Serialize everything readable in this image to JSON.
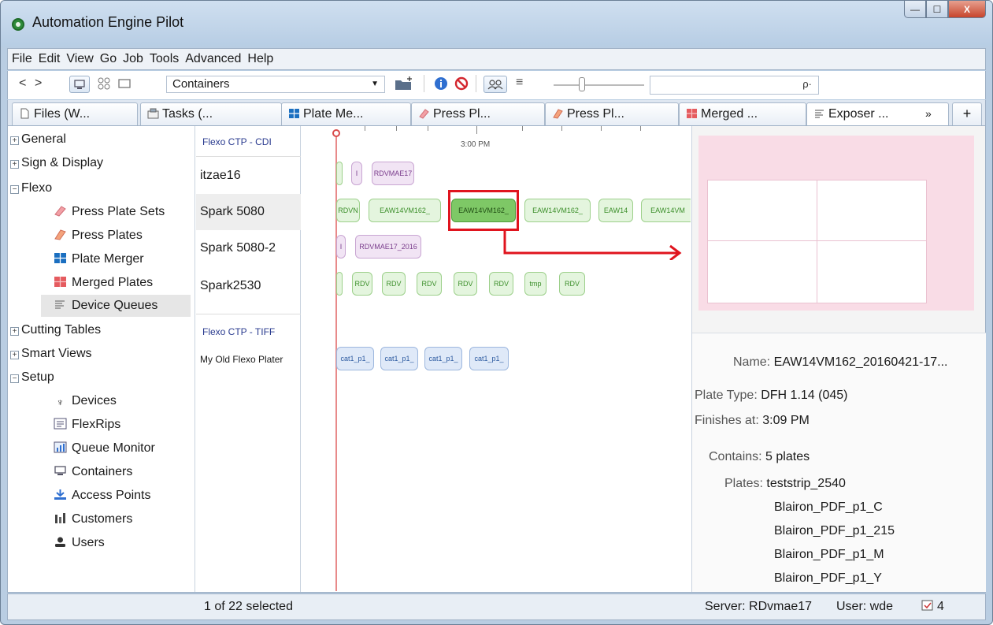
{
  "window": {
    "title": "Automation Engine Pilot",
    "minimize": "—",
    "maximize": "☐",
    "close": "X"
  },
  "menu": [
    "File",
    "Edit",
    "View",
    "Go",
    "Job",
    "Tools",
    "Advanced",
    "Help"
  ],
  "toolbar": {
    "back": "<",
    "forward": ">",
    "view_combo": "Containers",
    "search_placeholder": "",
    "search_icon": "ρ·"
  },
  "tabs": [
    {
      "label": "Files (W...",
      "icon": "file-icon"
    },
    {
      "label": "Tasks (...",
      "icon": "tasks-icon"
    },
    {
      "label": "Plate Me...",
      "icon": "plate-merger-icon"
    },
    {
      "label": "Press Pl...",
      "icon": "press-plate-sets-icon"
    },
    {
      "label": "Press Pl...",
      "icon": "press-plates-icon"
    },
    {
      "label": "Merged ...",
      "icon": "merged-plates-icon"
    },
    {
      "label": "Exposer ...",
      "icon": "device-queues-icon"
    },
    {
      "label": "»"
    },
    {
      "label": "+"
    }
  ],
  "sidebar": {
    "general": "General",
    "sign_display": "Sign & Display",
    "flexo": "Flexo",
    "flexo_items": [
      "Press Plate Sets",
      "Press Plates",
      "Plate Merger",
      "Merged Plates",
      "Device Queues"
    ],
    "cutting_tables": "Cutting Tables",
    "smart_views": "Smart Views",
    "setup": "Setup",
    "setup_items": [
      "Devices",
      "FlexRips",
      "Queue Monitor",
      "Containers",
      "Access Points",
      "Customers",
      "Users"
    ]
  },
  "devices": {
    "group1": "Flexo CTP - CDI",
    "rows1": [
      "itzae16",
      "Spark 5080",
      "Spark 5080-2",
      "Spark2530"
    ],
    "group2": "Flexo CTP - TIFF",
    "rows2": [
      "My Old Flexo Plater"
    ]
  },
  "timeline": {
    "time_label": "3:00 PM",
    "row1": [
      "I",
      "RDVMAE17"
    ],
    "row2": [
      "RDVN",
      "EAW14VM162_",
      "EAW14VM162_",
      "EAW14VM162_",
      "EAW14",
      "EAW14VM"
    ],
    "row3": [
      "I",
      "RDVMAE17_2016"
    ],
    "row4": [
      "",
      "RDV",
      "RDV",
      "RDV",
      "RDV",
      "RDV",
      "tmp",
      "RDV"
    ],
    "row5": [
      "cat1_p1_",
      "cat1_p1_",
      "cat1_p1_",
      "cat1_p1_"
    ]
  },
  "details": {
    "name_label": "Name:",
    "name_value": "EAW14VM162_20160421-17...",
    "plate_type_label": "Plate Type:",
    "plate_type_value": "DFH 1.14 (045)",
    "finishes_label": "Finishes at:",
    "finishes_value": "3:09 PM",
    "contains_label": "Contains:",
    "contains_value": "5 plates",
    "plates_label": "Plates:",
    "plates": [
      "teststrip_2540",
      "Blairon_PDF_p1_C",
      "Blairon_PDF_p1_215",
      "Blairon_PDF_p1_M",
      "Blairon_PDF_p1_Y"
    ]
  },
  "status": {
    "selection": "1 of 22 selected",
    "server": "Server: RDvmae17",
    "user": "User: wde",
    "count": "4"
  }
}
